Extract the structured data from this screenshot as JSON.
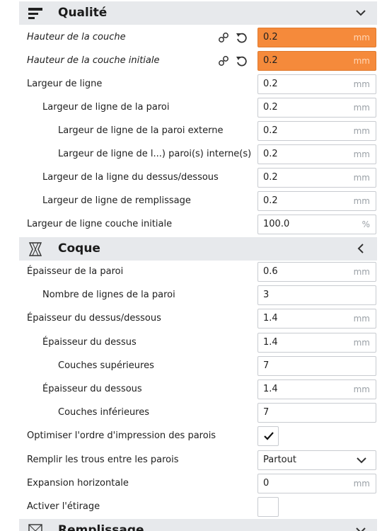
{
  "sections": {
    "quality": {
      "title": "Qualité",
      "icon": "quality-lines-icon"
    },
    "shell": {
      "title": "Coque",
      "icon": "shell-icon"
    },
    "infill": {
      "title": "Remplissage",
      "icon": "infill-icon"
    }
  },
  "quality_rows": [
    {
      "label": "Hauteur de la couche",
      "value": "0.2",
      "unit": "mm"
    },
    {
      "label": "Hauteur de la couche initiale",
      "value": "0.2",
      "unit": "mm"
    },
    {
      "label": "Largeur de ligne",
      "value": "0.2",
      "unit": "mm"
    },
    {
      "label": "Largeur de ligne de la paroi",
      "value": "0.2",
      "unit": "mm"
    },
    {
      "label": "Largeur de ligne de la paroi externe",
      "value": "0.2",
      "unit": "mm"
    },
    {
      "label": "Largeur de ligne de l...) paroi(s) interne(s)",
      "value": "0.2",
      "unit": "mm"
    },
    {
      "label": "Largeur de la ligne du dessus/dessous",
      "value": "0.2",
      "unit": "mm"
    },
    {
      "label": "Largeur de ligne de remplissage",
      "value": "0.2",
      "unit": "mm"
    },
    {
      "label": "Largeur de ligne couche initiale",
      "value": "100.0",
      "unit": "%"
    }
  ],
  "shell_rows": [
    {
      "label": "Épaisseur de la paroi",
      "value": "0.6",
      "unit": "mm"
    },
    {
      "label": "Nombre de lignes de la paroi",
      "value": "3"
    },
    {
      "label": "Épaisseur du dessus/dessous",
      "value": "1.4",
      "unit": "mm"
    },
    {
      "label": "Épaisseur du dessus",
      "value": "1.4",
      "unit": "mm"
    },
    {
      "label": "Couches supérieures",
      "value": "7"
    },
    {
      "label": "Épaisseur du dessous",
      "value": "1.4",
      "unit": "mm"
    },
    {
      "label": "Couches inférieures",
      "value": "7"
    },
    {
      "label": "Optimiser l'ordre d'impression des parois",
      "checked": true
    },
    {
      "label": "Remplir les trous entre les parois",
      "selected": "Partout"
    },
    {
      "label": "Expansion horizontale",
      "value": "0",
      "unit": "mm"
    },
    {
      "label": "Activer l'étirage",
      "checked": false
    }
  ],
  "colors": {
    "modified": "#f58a3b",
    "header_bg": "#e7e9ec"
  }
}
